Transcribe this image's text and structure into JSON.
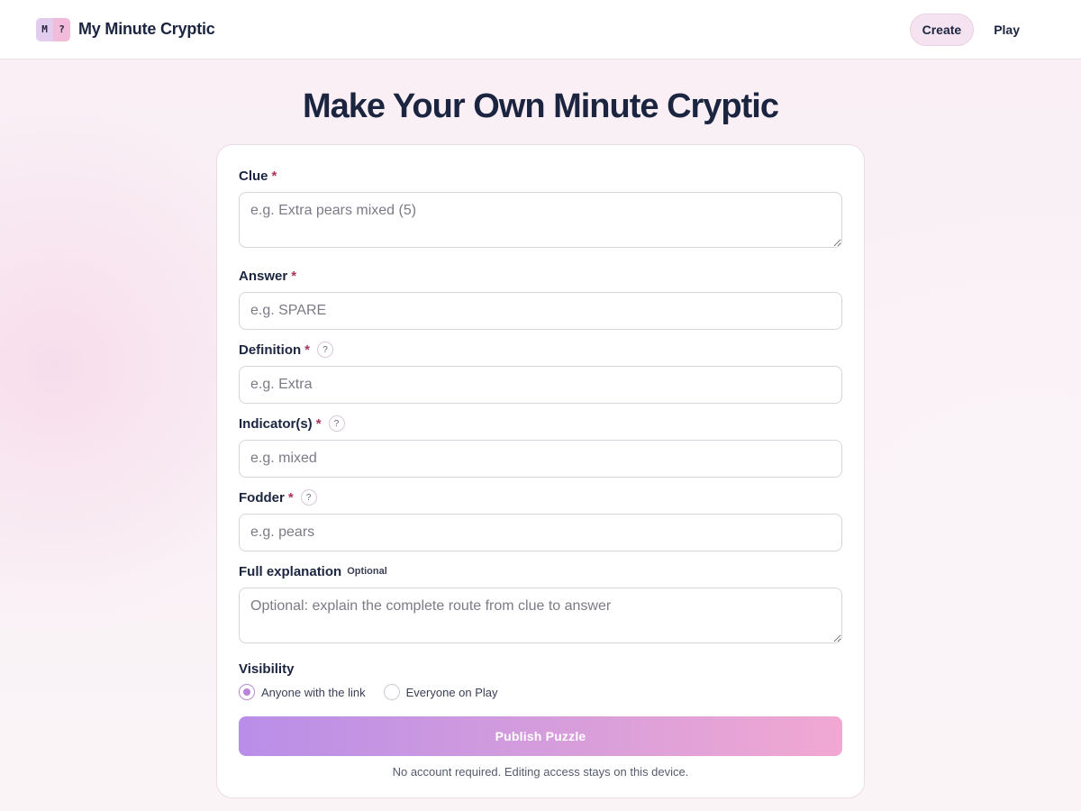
{
  "header": {
    "logo_left": "M",
    "logo_right": "?",
    "brand": "My Minute Cryptic",
    "nav": [
      {
        "label": "Create",
        "active": true
      },
      {
        "label": "Play",
        "active": false
      }
    ]
  },
  "page": {
    "title": "Make Your Own Minute Cryptic"
  },
  "form": {
    "clue": {
      "label": "Clue",
      "required_mark": "*",
      "placeholder": "e.g. Extra pears mixed (5)",
      "value": ""
    },
    "answer": {
      "label": "Answer",
      "required_mark": "*",
      "placeholder": "e.g. SPARE",
      "value": ""
    },
    "definition": {
      "label": "Definition",
      "required_mark": "*",
      "help": "?",
      "placeholder": "e.g. Extra",
      "value": ""
    },
    "indicators": {
      "label": "Indicator(s)",
      "required_mark": "*",
      "help": "?",
      "placeholder": "e.g. mixed",
      "value": ""
    },
    "fodder": {
      "label": "Fodder",
      "required_mark": "*",
      "help": "?",
      "placeholder": "e.g. pears",
      "value": ""
    },
    "explanation": {
      "label": "Full explanation",
      "optional_tag": "Optional",
      "placeholder": "Optional: explain the complete route from clue to answer",
      "value": ""
    },
    "visibility": {
      "label": "Visibility",
      "options": [
        {
          "label": "Anyone with the link",
          "checked": true
        },
        {
          "label": "Everyone on Play",
          "checked": false
        }
      ]
    },
    "submit_label": "Publish Puzzle",
    "note": "No account required. Editing access stays on this device."
  },
  "colors": {
    "accent_gradient_start": "#b98ee8",
    "accent_gradient_end": "#f1a8d2",
    "heading": "#1b2540",
    "required": "#a8345f"
  }
}
